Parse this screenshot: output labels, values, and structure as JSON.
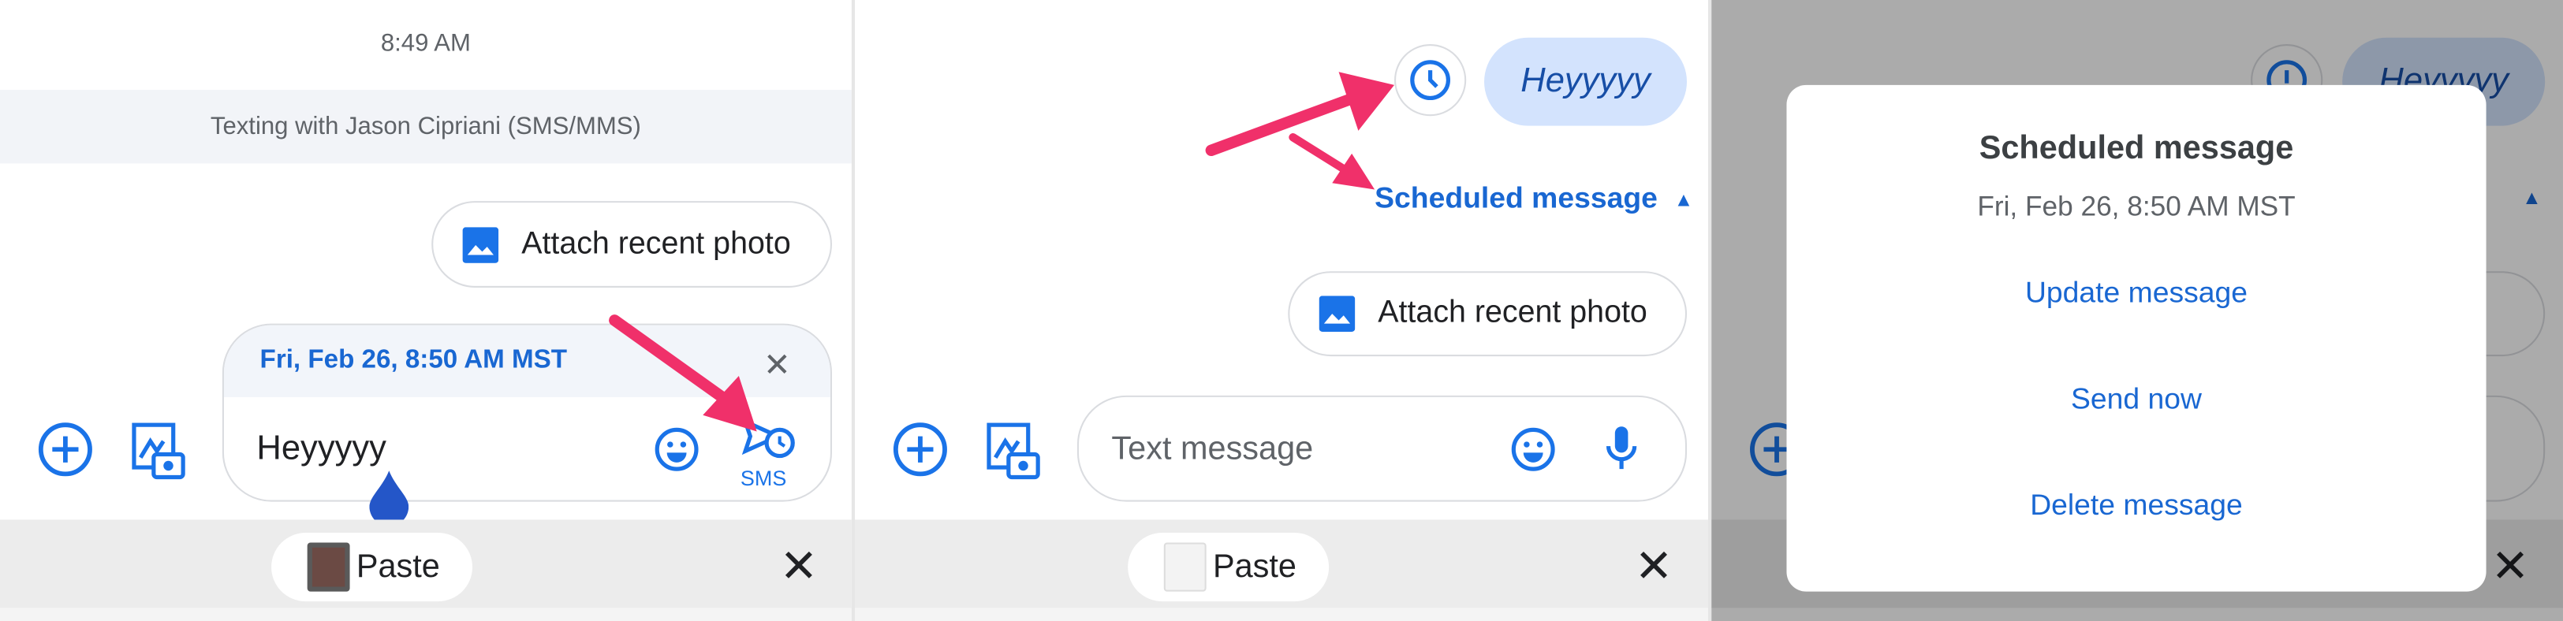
{
  "colors": {
    "accent": "#1a73e8",
    "arrow": "#f0306a",
    "bubble": "#d3e3fd"
  },
  "panel1": {
    "timestamp": "8:49 AM",
    "banner": "Texting with Jason Cipriani (SMS/MMS)",
    "attach_chip": "Attach recent photo",
    "schedule_header": "Fri, Feb 26, 8:50 AM MST",
    "compose_text": "Heyyyyy",
    "send_label": "SMS",
    "paste_label": "Paste",
    "icons": [
      "add-circle-icon",
      "gallery-camera-icon",
      "image-icon",
      "close-icon",
      "emoji-icon",
      "scheduled-send-icon",
      "text-cursor-handle"
    ]
  },
  "panel2": {
    "bubble_text": "Heyyyyy",
    "scheduled_label": "Scheduled message",
    "attach_chip": "Attach recent photo",
    "compose_placeholder": "Text message",
    "paste_label": "Paste",
    "icons": [
      "clock-icon",
      "caret-up-icon",
      "mic-icon"
    ]
  },
  "panel3": {
    "dialog_title": "Scheduled message",
    "dialog_date": "Fri, Feb 26, 8:50 AM MST",
    "actions": [
      "Update message",
      "Send now",
      "Delete message"
    ],
    "bg_bubble_text": "Heyyyyy"
  }
}
